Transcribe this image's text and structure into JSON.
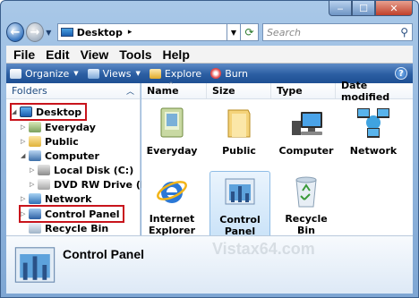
{
  "address": {
    "location": "Desktop",
    "separator": "▸",
    "search_placeholder": "Search"
  },
  "menu": {
    "file": "File",
    "edit": "Edit",
    "view": "View",
    "tools": "Tools",
    "help": "Help"
  },
  "toolbar": {
    "organize": "Organize",
    "views": "Views",
    "explore": "Explore",
    "burn": "Burn"
  },
  "nav": {
    "header": "Folders",
    "items": [
      {
        "label": "Desktop"
      },
      {
        "label": "Everyday"
      },
      {
        "label": "Public"
      },
      {
        "label": "Computer"
      },
      {
        "label": "Local Disk (C:)"
      },
      {
        "label": "DVD RW Drive (D:)"
      },
      {
        "label": "Network"
      },
      {
        "label": "Control Panel"
      },
      {
        "label": "Recycle Bin"
      }
    ]
  },
  "columns": [
    "Name",
    "Size",
    "Type",
    "Date modified"
  ],
  "items": [
    {
      "label": "Everyday"
    },
    {
      "label": "Public"
    },
    {
      "label": "Computer"
    },
    {
      "label": "Network"
    },
    {
      "label": "Internet Explorer"
    },
    {
      "label": "Control Panel"
    },
    {
      "label": "Recycle Bin"
    }
  ],
  "details": {
    "title": "Control Panel"
  },
  "watermark": "Vistax64.com",
  "colors": {
    "accent": "#2b5ea2",
    "highlight": "#c8141c"
  }
}
